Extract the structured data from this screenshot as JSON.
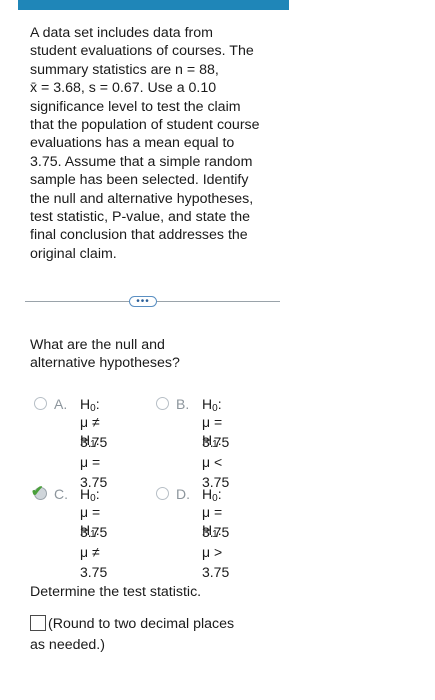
{
  "problem": {
    "lines": [
      "A data set includes data from",
      "student evaluations of courses. The",
      "summary statistics are n = 88,",
      "x̄ = 3.68, s = 0.67. Use a 0.10",
      "significance level to test the claim",
      "that the population of student course",
      "evaluations has a mean equal to",
      "3.75. Assume that a simple random",
      "sample has been selected. Identify",
      "the null and alternative hypotheses,",
      "test statistic, P-value, and state the",
      "final conclusion that addresses the",
      "original claim."
    ]
  },
  "divider": {
    "more_label": "•••"
  },
  "question": {
    "line1": "What are the null and",
    "line2": "alternative hypotheses?"
  },
  "options": [
    {
      "letter": "A.",
      "h0": "H",
      "h0_sub": "0",
      "h0_line": "μ ≠ 3.75",
      "h1": "H",
      "h1_sub": "1",
      "h1_line": "μ = 3.75",
      "selected": false
    },
    {
      "letter": "B.",
      "h0": "H",
      "h0_sub": "0",
      "h0_line": "μ = 3.75",
      "h1": "H",
      "h1_sub": "1",
      "h1_line": "μ < 3.75",
      "selected": false
    },
    {
      "letter": "C.",
      "h0": "H",
      "h0_sub": "0",
      "h0_line": "μ = 3.75",
      "h1": "H",
      "h1_sub": "1",
      "h1_line": "μ ≠ 3.75",
      "selected": true
    },
    {
      "letter": "D.",
      "h0": "H",
      "h0_sub": "0",
      "h0_line": "μ = 3.75",
      "h1": "H",
      "h1_sub": "1",
      "h1_line": "μ > 3.75",
      "selected": false
    }
  ],
  "colon": ":",
  "test_statistic": {
    "prompt": "Determine the test statistic.",
    "round_note_1": "(Round to two decimal places",
    "round_note_2": "as needed.)"
  },
  "colors": {
    "topbar": "#1f86b8",
    "check": "#4aa03a"
  }
}
